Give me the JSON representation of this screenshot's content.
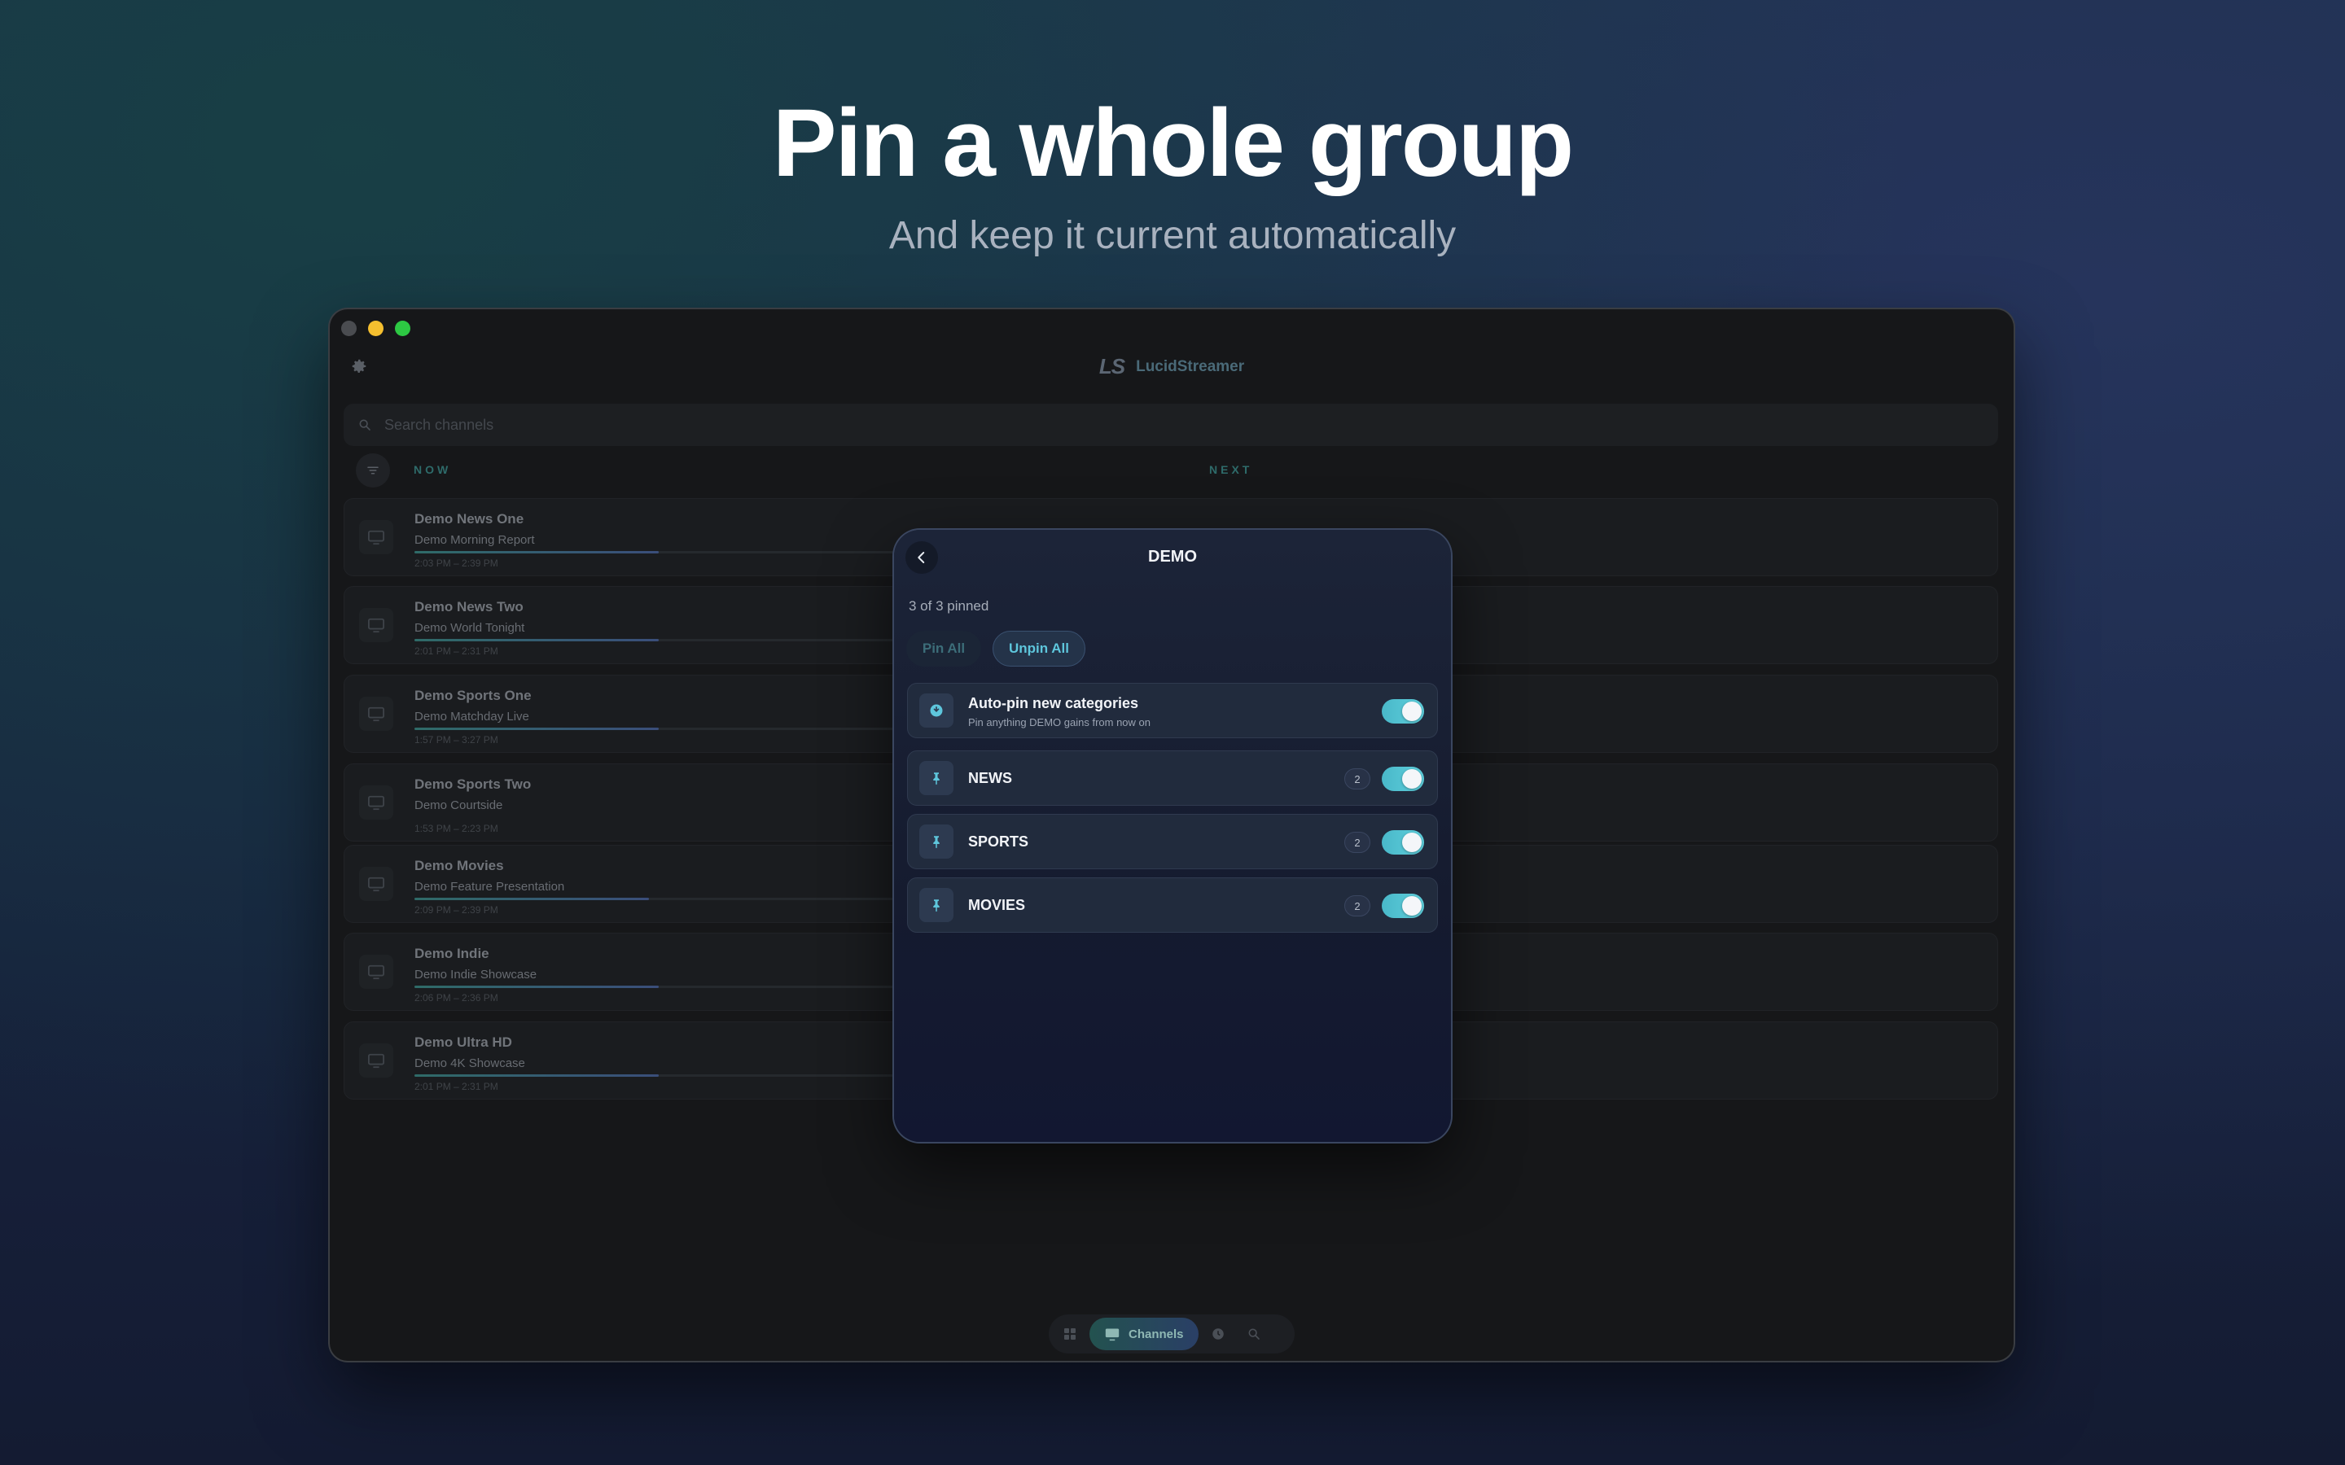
{
  "hero": {
    "title": "Pin a whole group",
    "subtitle": "And keep it current automatically"
  },
  "app": {
    "name": "LucidStreamer",
    "logo_text": "LS",
    "search_placeholder": "Search channels"
  },
  "columns": {
    "now": "NOW",
    "next": "NEXT"
  },
  "channels": [
    {
      "name": "Demo News One",
      "program": "Demo Morning Report",
      "time": "2:03 PM – 2:39 PM",
      "progress": 0.5
    },
    {
      "name": "Demo News Two",
      "program": "Demo World Tonight",
      "time": "2:01 PM – 2:31 PM",
      "progress": 0.5
    },
    {
      "name": "Demo Sports One",
      "program": "Demo Matchday Live",
      "time": "1:57 PM – 3:27 PM",
      "progress": 0.5
    },
    {
      "name": "Demo Sports Two",
      "program": "Demo Courtside",
      "time": "1:53 PM – 2:23 PM",
      "progress": 0.0
    },
    {
      "name": "Demo Movies",
      "program": "Demo Feature Presentation",
      "time": "2:09 PM – 2:39 PM",
      "progress": 0.48
    },
    {
      "name": "Demo Indie",
      "program": "Demo Indie Showcase",
      "time": "2:06 PM – 2:36 PM",
      "progress": 0.5
    },
    {
      "name": "Demo Ultra HD",
      "program": "Demo 4K Showcase",
      "time": "2:01 PM – 2:31 PM",
      "progress": 0.5
    }
  ],
  "tabbar": {
    "active_label": "Channels",
    "icons": [
      "grid-icon",
      "tv-icon",
      "clock-icon",
      "search-icon"
    ]
  },
  "modal": {
    "title": "DEMO",
    "pinned_count": "3 of 3 pinned",
    "pin_all_label": "Pin All",
    "unpin_all_label": "Unpin All",
    "auto_pin": {
      "title": "Auto-pin new categories",
      "subtitle": "Pin anything DEMO gains from now on",
      "enabled": true
    },
    "categories": [
      {
        "name": "NEWS",
        "count": "2",
        "pinned": true
      },
      {
        "name": "SPORTS",
        "count": "2",
        "pinned": true
      },
      {
        "name": "MOVIES",
        "count": "2",
        "pinned": true
      }
    ]
  },
  "colors": {
    "accent": "#5ec6dc",
    "toggle_on": "#49b8c9",
    "macos_close": "#4a4c50",
    "macos_min": "#f5bf2f",
    "macos_max": "#2dc843"
  }
}
